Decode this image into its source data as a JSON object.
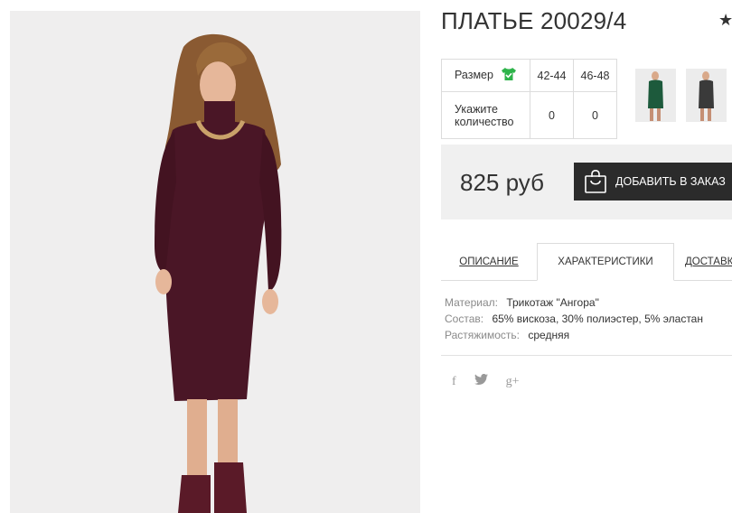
{
  "product": {
    "title": "ПЛАТЬЕ 20029/4",
    "favorite_icon": "star-icon"
  },
  "size_table": {
    "size_label": "Размер",
    "size_icon": "tshirt-check-icon",
    "sizes": [
      "42-44",
      "46-48"
    ],
    "quantity_label": "Укажите количество",
    "quantities": [
      "0",
      "0"
    ]
  },
  "thumbnails": [
    {
      "icon": "dress-green-thumbnail"
    },
    {
      "icon": "dress-grey-thumbnail"
    }
  ],
  "purchase": {
    "price": "825 руб",
    "add_to_cart_label": "ДОБАВИТЬ В ЗАКАЗ",
    "cart_icon": "shopping-bag-icon"
  },
  "tabs": [
    {
      "label": "ОПИСАНИЕ",
      "active": false
    },
    {
      "label": "ХАРАКТЕРИСТИКИ",
      "active": true
    },
    {
      "label": "ДОСТАВКА",
      "active": false
    }
  ],
  "specs": [
    {
      "key": "Материал:",
      "value": "Трикотаж \"Ангора\""
    },
    {
      "key": "Состав:",
      "value": "65% вискоза, 30% полиэстер, 5% эластан"
    },
    {
      "key": "Растяжимость:",
      "value": "средняя"
    }
  ],
  "social": {
    "facebook": "f",
    "twitter": "twitter-icon",
    "googleplus": "g+"
  },
  "colors": {
    "dress": "#4a1626",
    "button_bg": "#2b2b2b",
    "panel_bg": "#f0f0f0",
    "check_green": "#2db34a"
  }
}
